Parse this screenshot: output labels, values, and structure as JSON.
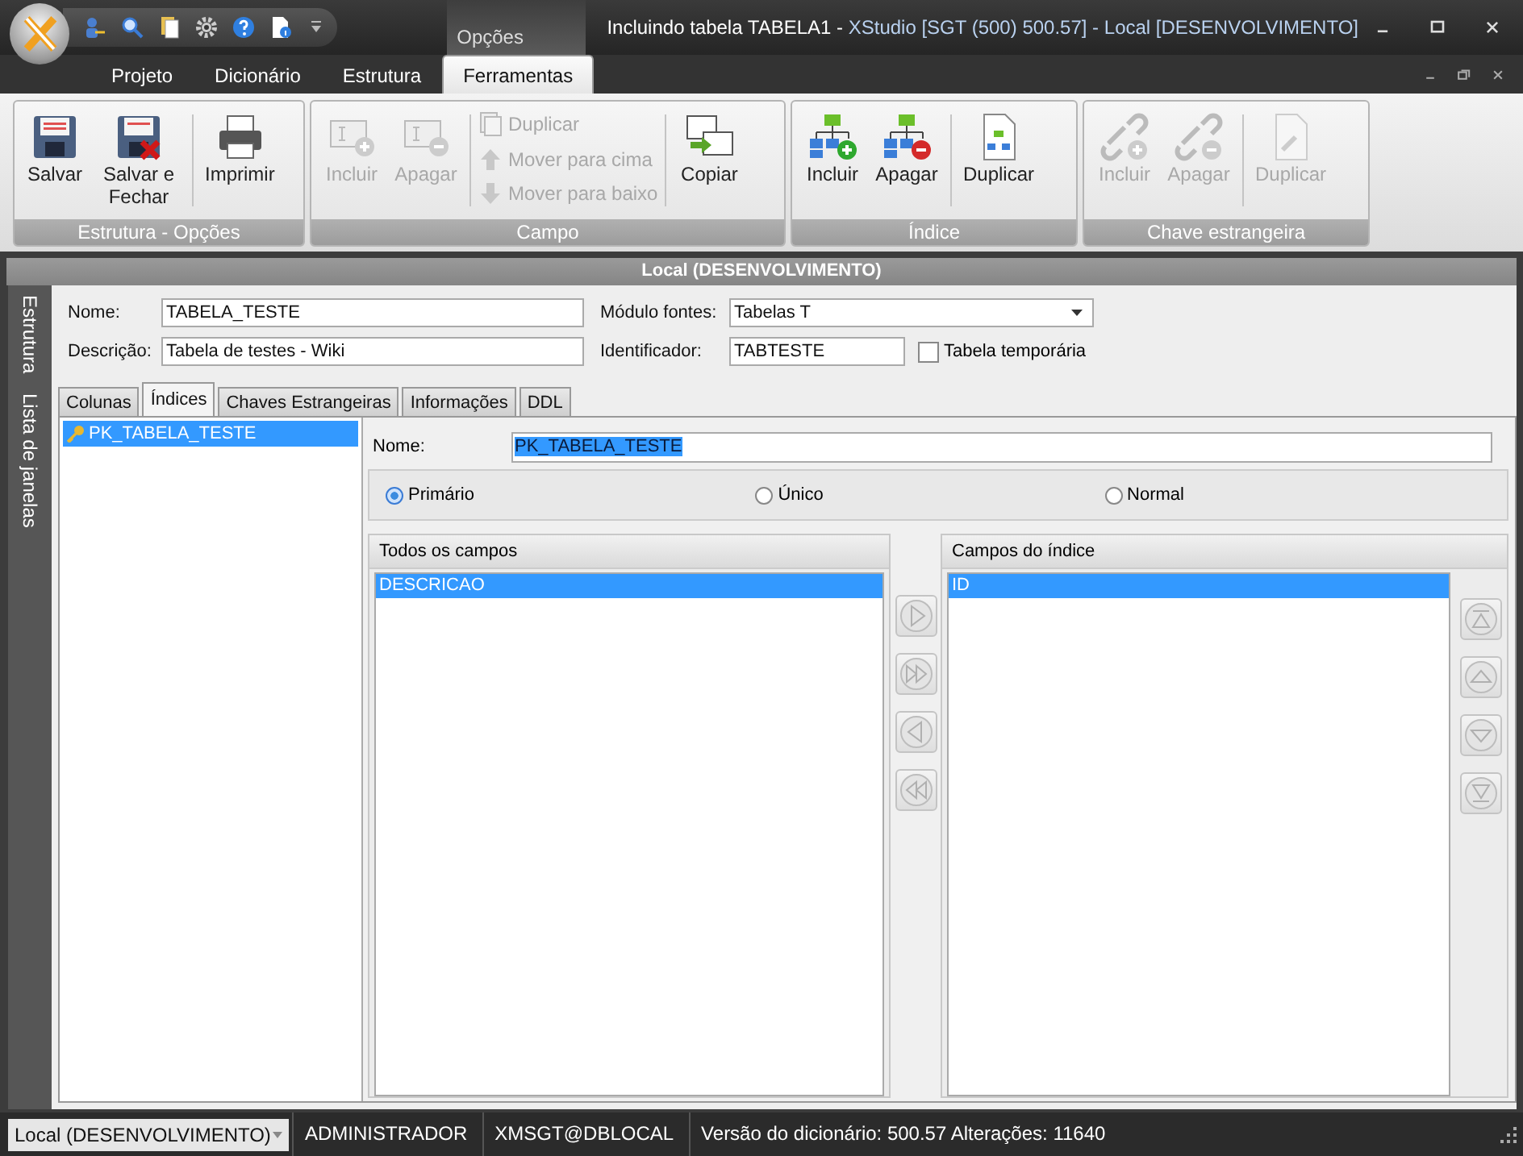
{
  "window": {
    "title": "Incluindo tabela TABELA1 - ",
    "title_app": "XStudio [SGT (500) 500.57] - Local [DESENVOLVIMENTO]",
    "contextual_tab": "Opções"
  },
  "ribbon_tabs": [
    {
      "label": "Projeto",
      "selected": false
    },
    {
      "label": "Dicionário",
      "selected": false
    },
    {
      "label": "Estrutura",
      "selected": false
    },
    {
      "label": "Ferramentas",
      "selected": true
    }
  ],
  "ribbon_groups": [
    {
      "title": "Estrutura - Opções",
      "sections": [
        [
          {
            "label": "Salvar",
            "kind": "large",
            "disabled": false
          },
          {
            "label": "Salvar e Fechar",
            "kind": "large",
            "disabled": false
          }
        ],
        [
          {
            "label": "Imprimir",
            "kind": "large",
            "disabled": false
          }
        ]
      ]
    },
    {
      "title": "Campo",
      "sections": [
        [
          {
            "label": "Incluir",
            "kind": "large",
            "disabled": true
          },
          {
            "label": "Apagar",
            "kind": "large",
            "disabled": true
          }
        ],
        [
          {
            "label": "Duplicar",
            "kind": "small",
            "disabled": true
          },
          {
            "label": "Mover para cima",
            "kind": "small",
            "disabled": true
          },
          {
            "label": "Mover para baixo",
            "kind": "small",
            "disabled": true
          }
        ],
        [
          {
            "label": "Copiar",
            "kind": "large",
            "disabled": false
          }
        ]
      ]
    },
    {
      "title": "Índice",
      "sections": [
        [
          {
            "label": "Incluir",
            "kind": "large",
            "disabled": false
          },
          {
            "label": "Apagar",
            "kind": "large",
            "disabled": false
          }
        ],
        [
          {
            "label": "Duplicar",
            "kind": "large",
            "disabled": false
          }
        ]
      ]
    },
    {
      "title": "Chave estrangeira",
      "sections": [
        [
          {
            "label": "Incluir",
            "kind": "large",
            "disabled": true
          },
          {
            "label": "Apagar",
            "kind": "large",
            "disabled": true
          }
        ],
        [
          {
            "label": "Duplicar",
            "kind": "large",
            "disabled": true
          }
        ]
      ]
    }
  ],
  "header": "Local (DESENVOLVIMENTO)",
  "side_tabs": [
    "Estrutura",
    "Lista de janelas"
  ],
  "fields": [
    {
      "label": "Nome:",
      "value": "TABELA_TESTE",
      "kind": "text"
    },
    {
      "label": "Módulo fontes:",
      "value": "Tabelas T",
      "kind": "dropdown"
    },
    {
      "label": "Descrição:",
      "value": "Tabela de testes - Wiki",
      "kind": "text"
    },
    {
      "label": "Identificador:",
      "value": "TABTESTE",
      "kind": "text"
    }
  ],
  "temporary": {
    "label": "Tabela temporária",
    "checked": false
  },
  "tabs": [
    {
      "label": "Colunas",
      "selected": false
    },
    {
      "label": "Índices",
      "selected": true
    },
    {
      "label": "Chaves Estrangeiras",
      "selected": false
    },
    {
      "label": "Informações",
      "selected": false
    },
    {
      "label": "DDL",
      "selected": false
    }
  ],
  "indexes": [
    {
      "label": "PK_TABELA_TESTE",
      "selected": true
    }
  ],
  "index_name": {
    "label": "Nome:",
    "value": "PK_TABELA_TESTE"
  },
  "index_types": [
    {
      "label": "Primário",
      "selected": true
    },
    {
      "label": "Único",
      "selected": false
    },
    {
      "label": "Normal",
      "selected": false
    }
  ],
  "all_fields": {
    "title": "Todos os campos",
    "items": [
      {
        "label": "DESCRICAO",
        "selected": true
      }
    ]
  },
  "index_fields": {
    "title": "Campos do índice",
    "items": [
      {
        "label": "ID",
        "selected": true
      }
    ]
  },
  "status_bar": {
    "connection": "Local (DESENVOLVIMENTO)",
    "items": [
      "ADMINISTRADOR",
      "XMSGT@DBLOCAL",
      "Versão do dicionário: 500.57 Alterações: 11640"
    ]
  }
}
